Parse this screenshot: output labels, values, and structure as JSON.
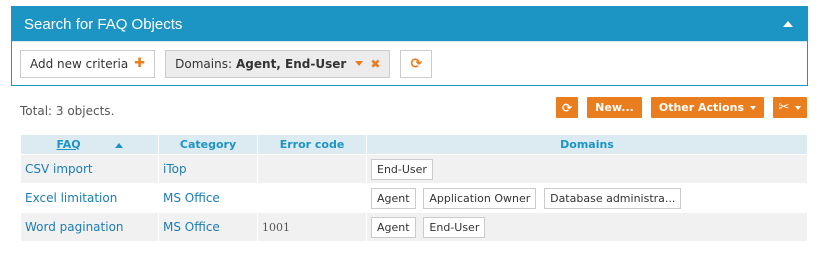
{
  "search": {
    "title": "Search for FAQ Objects",
    "add_criteria_label": "Add new criteria",
    "criterion": {
      "name": "Domains:",
      "value": "Agent, End-User"
    }
  },
  "results": {
    "total_label": "Total: 3 objects.",
    "toolbar": {
      "new_label": "New...",
      "actions_label": "Other Actions"
    },
    "columns": [
      "FAQ",
      "Category",
      "Error code",
      "Domains"
    ],
    "rows": [
      {
        "faq": "CSV import",
        "category": "iTop",
        "error_code": "",
        "domains": [
          "End-User"
        ]
      },
      {
        "faq": "Excel limitation",
        "category": "MS Office",
        "error_code": "",
        "domains": [
          "Agent",
          "Application Owner",
          "Database administra..."
        ]
      },
      {
        "faq": "Word pagination",
        "category": "MS Office",
        "error_code": "1001",
        "domains": [
          "Agent",
          "End-User"
        ]
      }
    ]
  },
  "colors": {
    "header_blue": "#1c94c4",
    "accent_orange": "#ea7d1e",
    "table_header_bg": "#dceaf2",
    "link": "#1c7db3"
  },
  "icons": [
    "collapse-icon",
    "plus-icon",
    "caret-down-icon",
    "remove-icon",
    "refresh-icon",
    "sort-asc-icon",
    "tools-icon"
  ]
}
